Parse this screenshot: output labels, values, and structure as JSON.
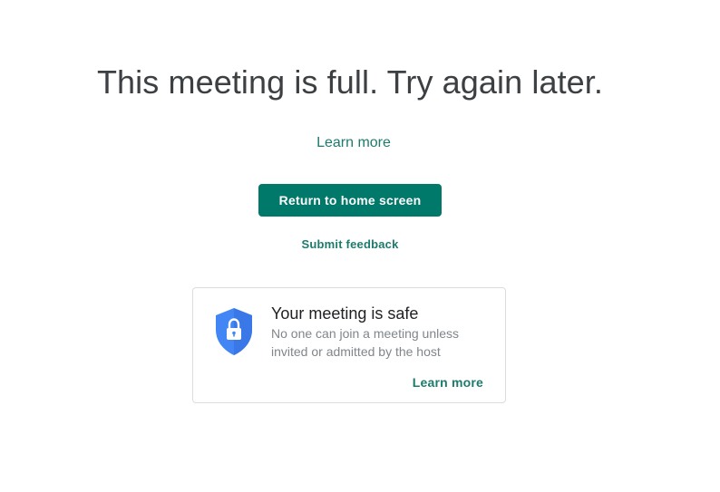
{
  "main": {
    "headline": "This meeting is full. Try again later.",
    "learn_more_label": "Learn more",
    "return_button_label": "Return to home screen",
    "feedback_label": "Submit feedback"
  },
  "safety_card": {
    "title": "Your meeting is safe",
    "description": "No one can join a meeting unless invited or admitted by the host",
    "learn_more_label": "Learn more",
    "icon": "shield-lock-icon"
  },
  "colors": {
    "accent": "#00796b",
    "link": "#1e7b6c",
    "shield": "#4285f4",
    "headline": "#3c4043"
  }
}
